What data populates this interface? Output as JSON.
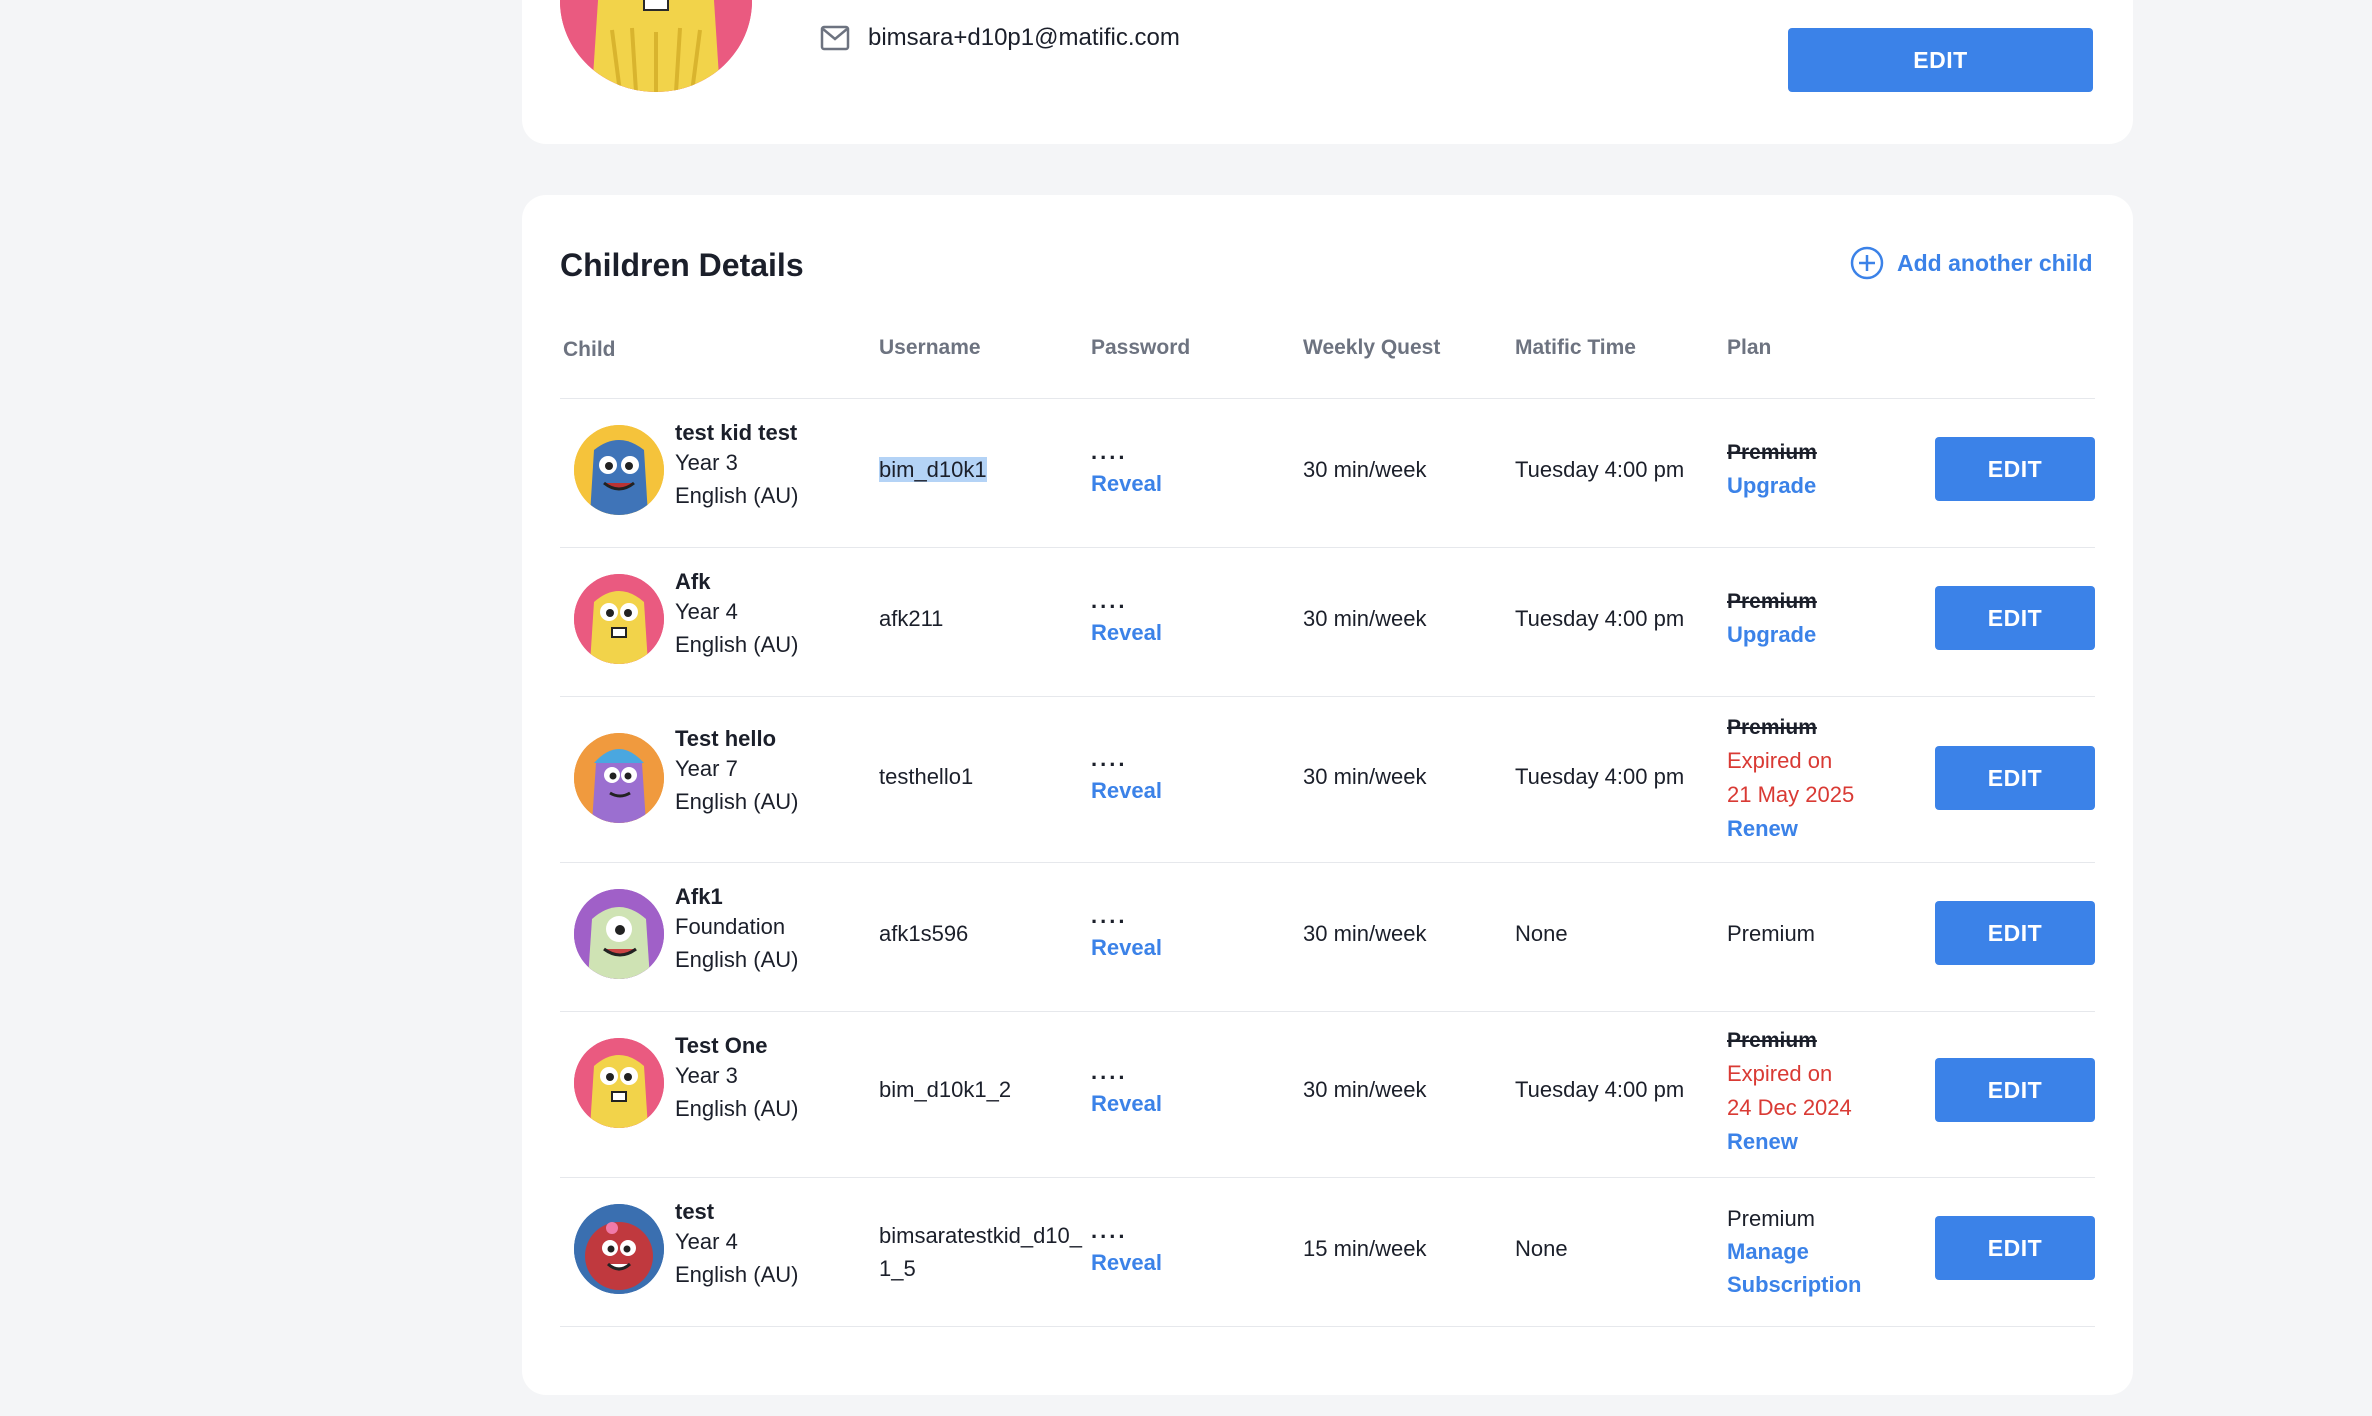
{
  "profile": {
    "email": "bimsara+d10p1@matific.com",
    "edit_label": "EDIT"
  },
  "children_section": {
    "title": "Children Details",
    "add_child_label": "Add another child",
    "columns": {
      "child": "Child",
      "username": "Username",
      "password": "Password",
      "weekly_quest": "Weekly Quest",
      "matific_time": "Matific Time",
      "plan": "Plan"
    },
    "rows": [
      {
        "name": "test kid test",
        "year": "Year 3",
        "locale": "English (AU)",
        "username": "bim_d10k1",
        "password_mask": "....",
        "reveal": "Reveal",
        "weekly_quest": "30 min/week",
        "matific_time": "Tuesday 4:00 pm",
        "plan": "Premium",
        "action": "Upgrade",
        "edit": "EDIT"
      },
      {
        "name": "Afk",
        "year": "Year 4",
        "locale": "English (AU)",
        "username": "afk211",
        "password_mask": "....",
        "reveal": "Reveal",
        "weekly_quest": "30 min/week",
        "matific_time": "Tuesday 4:00 pm",
        "plan": "Premium",
        "action": "Upgrade",
        "edit": "EDIT"
      },
      {
        "name": "Test hello",
        "year": "Year 7",
        "locale": "English (AU)",
        "username": "testhello1",
        "password_mask": "....",
        "reveal": "Reveal",
        "weekly_quest": "30 min/week",
        "matific_time": "Tuesday 4:00 pm",
        "plan": "Premium",
        "expired_line1": "Expired on",
        "expired_line2": "21 May 2025",
        "action": "Renew",
        "edit": "EDIT"
      },
      {
        "name": "Afk1",
        "year": "Foundation",
        "locale": "English (AU)",
        "username": "afk1s596",
        "password_mask": "....",
        "reveal": "Reveal",
        "weekly_quest": "30 min/week",
        "matific_time": "None",
        "plan": "Premium",
        "edit": "EDIT"
      },
      {
        "name": "Test One",
        "year": "Year 3",
        "locale": "English (AU)",
        "username": "bim_d10k1_2",
        "password_mask": "....",
        "reveal": "Reveal",
        "weekly_quest": "30 min/week",
        "matific_time": "Tuesday 4:00 pm",
        "plan": "Premium",
        "expired_line1": "Expired on",
        "expired_line2": "24 Dec 2024",
        "action": "Renew",
        "edit": "EDIT"
      },
      {
        "name": "test",
        "year": "Year 4",
        "locale": "English (AU)",
        "username_line1": "bimsaratestkid_d10_",
        "username_line2": "1_5",
        "password_mask": "....",
        "reveal": "Reveal",
        "weekly_quest": "15 min/week",
        "matific_time": "None",
        "plan": "Premium",
        "action_line1": "Manage",
        "action_line2": "Subscription",
        "edit": "EDIT"
      }
    ]
  },
  "colors": {
    "accent": "#3b82e8",
    "expired": "#d93a34",
    "page_bg": "#f4f5f7"
  }
}
